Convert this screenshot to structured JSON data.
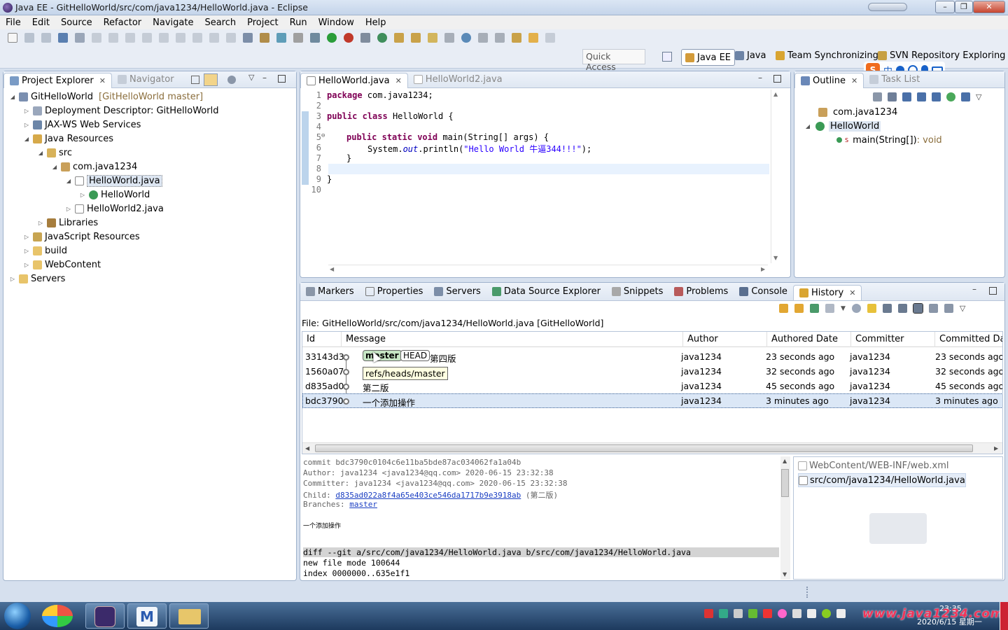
{
  "window": {
    "title": "Java EE - GitHelloWorld/src/com/java1234/HelloWorld.java - Eclipse"
  },
  "menu": [
    "File",
    "Edit",
    "Source",
    "Refactor",
    "Navigate",
    "Search",
    "Project",
    "Run",
    "Window",
    "Help"
  ],
  "toolbar": {
    "quick_access": "Quick Access",
    "perspectives": [
      "Java EE",
      "Java",
      "Team Synchronizing",
      "SVN Repository Exploring"
    ]
  },
  "explorer": {
    "tabs": [
      "Project Explorer",
      "Navigator"
    ],
    "tree": [
      {
        "label": "GitHelloWorld",
        "suffix": "[GitHelloWorld master]"
      },
      {
        "label": "Deployment Descriptor: GitHelloWorld"
      },
      {
        "label": "JAX-WS Web Services"
      },
      {
        "label": "Java Resources"
      },
      {
        "label": "src"
      },
      {
        "label": "com.java1234"
      },
      {
        "label": "HelloWorld.java"
      },
      {
        "label": "HelloWorld"
      },
      {
        "label": "HelloWorld2.java"
      },
      {
        "label": "Libraries"
      },
      {
        "label": "JavaScript Resources"
      },
      {
        "label": "build"
      },
      {
        "label": "WebContent"
      },
      {
        "label": "Servers"
      }
    ]
  },
  "editor": {
    "tabs": [
      "HelloWorld.java",
      "HelloWorld2.java"
    ],
    "line_numbers": [
      "1",
      "2",
      "3",
      "4",
      "5",
      "6",
      "7",
      "8",
      "9",
      "10"
    ],
    "code": {
      "l1_kw": "package",
      "l1_rest": " com.java1234;",
      "l3_kw1": "public",
      "l3_kw2": "class",
      "l3_rest": " HelloWorld {",
      "l5_kw1": "public",
      "l5_kw2": "static",
      "l5_kw3": "void",
      "l5_rest": " main(String[] args) {",
      "l6_a": "System.",
      "l6_out": "out",
      "l6_b": ".println(",
      "l6_str": "\"Hello World 牛逼344!!!\"",
      "l6_c": ");",
      "l7": "}",
      "l9": "}"
    }
  },
  "outline": {
    "tabs": [
      "Outline",
      "Task List"
    ],
    "items": [
      "com.java1234",
      "HelloWorld",
      "main(String[])"
    ],
    "method_type": " : void"
  },
  "bottom": {
    "tabs": [
      "Markers",
      "Properties",
      "Servers",
      "Data Source Explorer",
      "Snippets",
      "Problems",
      "Console",
      "History"
    ],
    "file_label": "File: GitHelloWorld/src/com/java1234/HelloWorld.java [GitHelloWorld]",
    "columns": [
      "Id",
      "Message",
      "Author",
      "Authored Date",
      "Committer",
      "Committed Date"
    ],
    "commits": [
      {
        "id": "33143d3",
        "branch": "master",
        "head": "HEAD",
        "message": "第四版",
        "author": "java1234",
        "authored": "23 seconds ago",
        "committer": "java1234",
        "committed": "23 seconds ago"
      },
      {
        "id": "1560a07",
        "message": "",
        "author": "java1234",
        "authored": "32 seconds ago",
        "committer": "java1234",
        "committed": "32 seconds ago"
      },
      {
        "id": "d835ad0",
        "message": "第二版",
        "author": "java1234",
        "authored": "45 seconds ago",
        "committer": "java1234",
        "committed": "45 seconds ago"
      },
      {
        "id": "bdc3790",
        "message": "一个添加操作",
        "author": "java1234",
        "authored": "3 minutes ago",
        "committer": "java1234",
        "committed": "3 minutes ago"
      }
    ],
    "tooltip": "refs/heads/master",
    "details": {
      "commit": "commit bdc3790c0104c6e11ba5bde87ac034062fa1a04b",
      "author": "Author: java1234 <java1234@qq.com> 2020-06-15 23:32:38",
      "committer": "Committer: java1234 <java1234@qq.com> 2020-06-15 23:32:38",
      "child_label": "Child: ",
      "child_link": "d835ad022a8f4a65e403ce546da1717b9e3918ab",
      "child_note": " (第二版)",
      "branches_label": "Branches: ",
      "branches_link": "master",
      "message": "一个添加操作",
      "diff1": "diff --git a/src/com/java1234/HelloWorld.java b/src/com/java1234/HelloWorld.java",
      "diff2": "new file mode 100644",
      "diff3": "index 0000000..635e1f1"
    },
    "files": [
      "WebContent/WEB-INF/web.xml",
      "src/com/java1234/HelloWorld.java"
    ]
  },
  "taskbar": {
    "time": "23:35",
    "date": "2020/6/15 星期一",
    "watermark": "www.java1234.com"
  }
}
